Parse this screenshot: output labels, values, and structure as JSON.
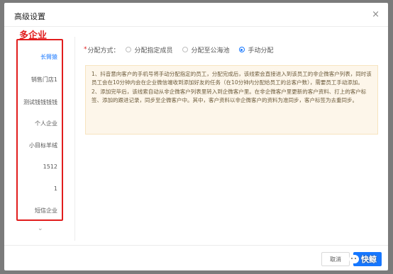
{
  "dialog": {
    "title": "高级设置",
    "close_symbol": "×"
  },
  "annotation": {
    "label": "多企业",
    "color": "#e11d1d"
  },
  "sidebar": {
    "items": [
      {
        "label": "长臂猿",
        "active": true
      },
      {
        "label": "销售门店1",
        "active": false
      },
      {
        "label": "测试钱钱钱钱",
        "active": false
      },
      {
        "label": "个人企业",
        "active": false
      },
      {
        "label": "小目标羊绒",
        "active": false
      },
      {
        "label": "1512",
        "active": false
      },
      {
        "label": "1",
        "active": false
      },
      {
        "label": "短信企业",
        "active": false
      }
    ],
    "more_symbol": "⌄"
  },
  "assign_mode": {
    "required_mark": "*",
    "label": "分配方式：",
    "options": [
      {
        "label": "分配指定成员",
        "selected": false
      },
      {
        "label": "分配至公海池",
        "selected": false
      },
      {
        "label": "手动分配",
        "selected": true
      }
    ]
  },
  "notice": {
    "paragraphs": [
      "1、抖音意向客户的手机号将手动分配指定的员工，分配完成后，该线索会直接进入到该员工的非企微客户列表，同时该员工会在10分钟内会在企业微信端收到添加好友的任务（在10分钟内分配给员工的总客户数），需要员工手动添加。",
      "2、添加完毕后，该线索自动从非企微客户列表里转入到企微客户里。在非企微客户里更新的客户资料、打上的客户标签、添加的跟进记录，同步至企微客户中。其中，客户资料以非企微客户的资料为准同步，客户标签为去重同步。"
    ]
  },
  "footer": {
    "cancel_label": "取消",
    "watermark_text": "快鲸"
  },
  "colors": {
    "accent": "#1677ff",
    "annotation_red": "#e11d1d",
    "notice_bg": "#fdf6ea"
  }
}
